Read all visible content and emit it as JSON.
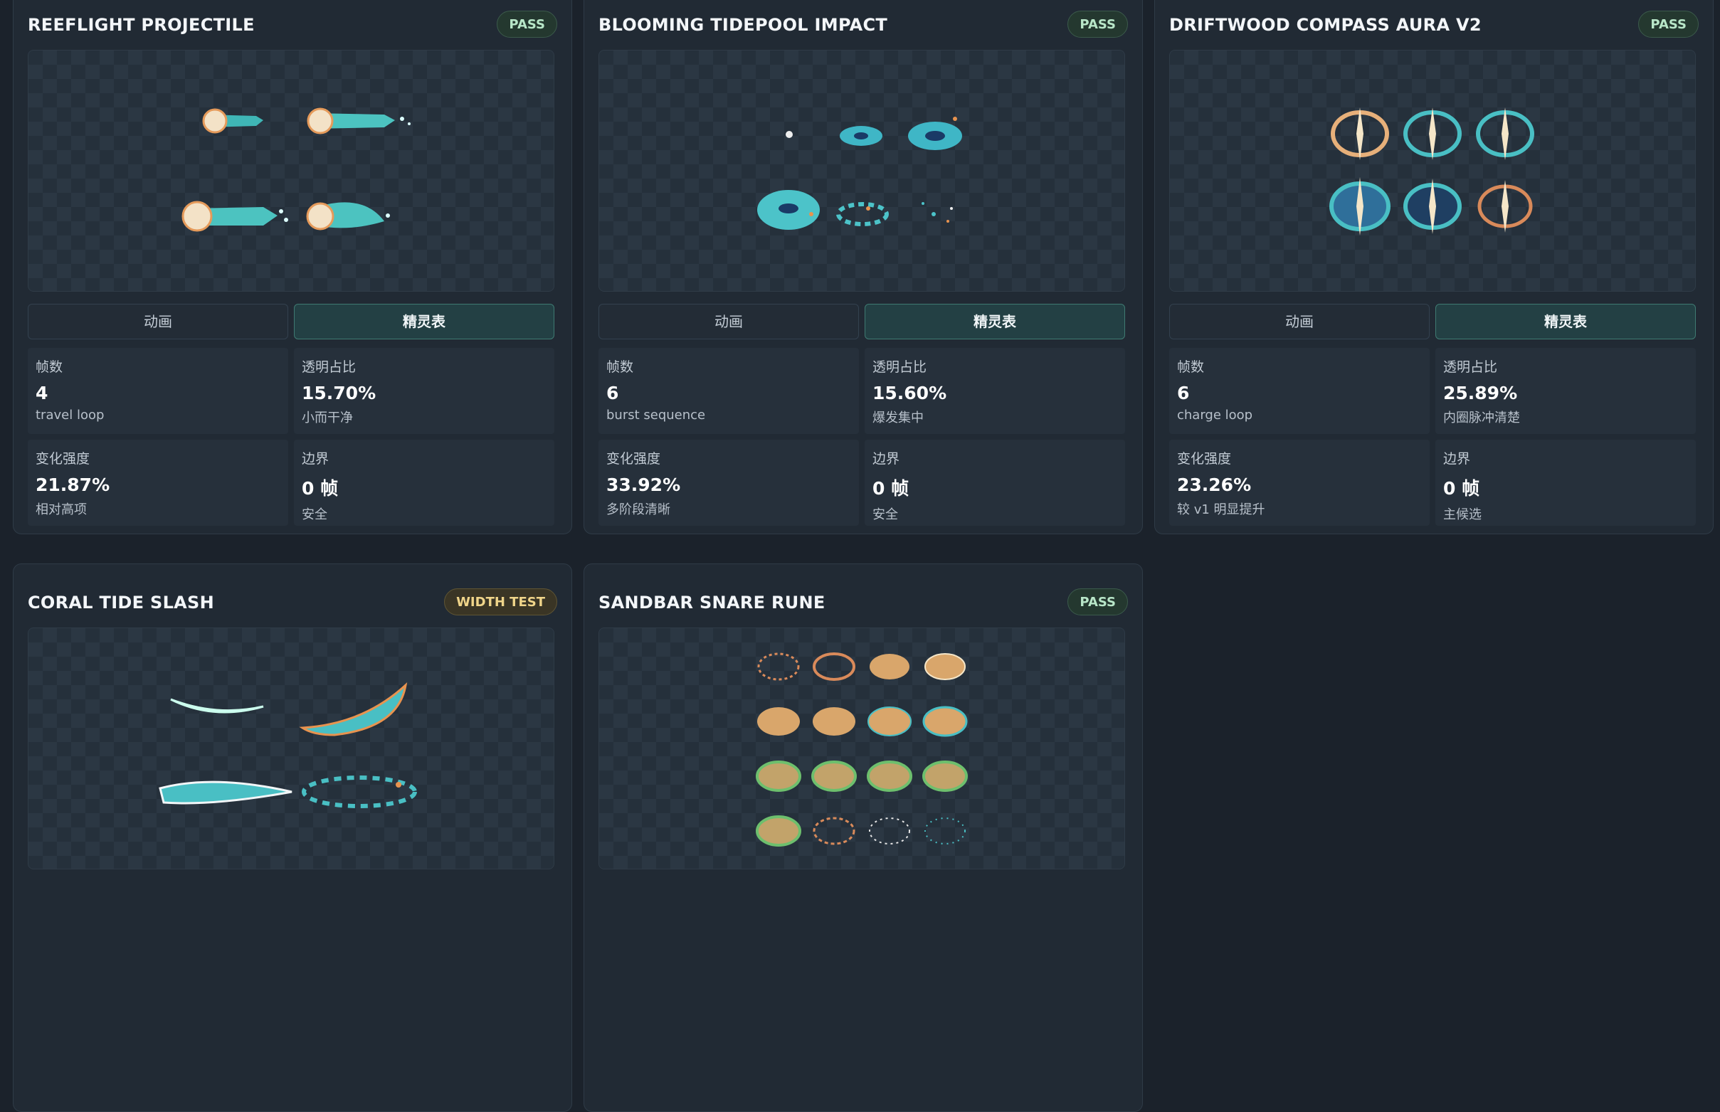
{
  "labels": {
    "frames": "帧数",
    "alpha": "透明占比",
    "variance": "变化强度",
    "border": "边界",
    "tab_anim": "动画",
    "tab_sheet": "精灵表"
  },
  "colors": {
    "accent_teal": "#3f7a72",
    "pass_bg": "#24382f",
    "width_test_text": "#f0d58a"
  },
  "cards": [
    {
      "title": "REEFLIGHT PROJECTILE",
      "badge": "PASS",
      "frames": "4",
      "frames_note": "travel loop",
      "alpha": "15.70%",
      "alpha_note": "小而干净",
      "variance": "21.87%",
      "variance_note": "相对高项",
      "border": "0 帧",
      "border_note": "安全"
    },
    {
      "title": "BLOOMING TIDEPOOL IMPACT",
      "badge": "PASS",
      "frames": "6",
      "frames_note": "burst sequence",
      "alpha": "15.60%",
      "alpha_note": "爆发集中",
      "variance": "33.92%",
      "variance_note": "多阶段清晰",
      "border": "0 帧",
      "border_note": "安全"
    },
    {
      "title": "DRIFTWOOD COMPASS AURA V2",
      "badge": "PASS",
      "frames": "6",
      "frames_note": "charge loop",
      "alpha": "25.89%",
      "alpha_note": "内圈脉冲清楚",
      "variance": "23.26%",
      "variance_note": "较 v1 明显提升",
      "border": "0 帧",
      "border_note": "主候选"
    },
    {
      "title": "CORAL TIDE SLASH",
      "badge": "WIDTH TEST"
    },
    {
      "title": "SANDBAR SNARE RUNE",
      "badge": "PASS"
    }
  ]
}
